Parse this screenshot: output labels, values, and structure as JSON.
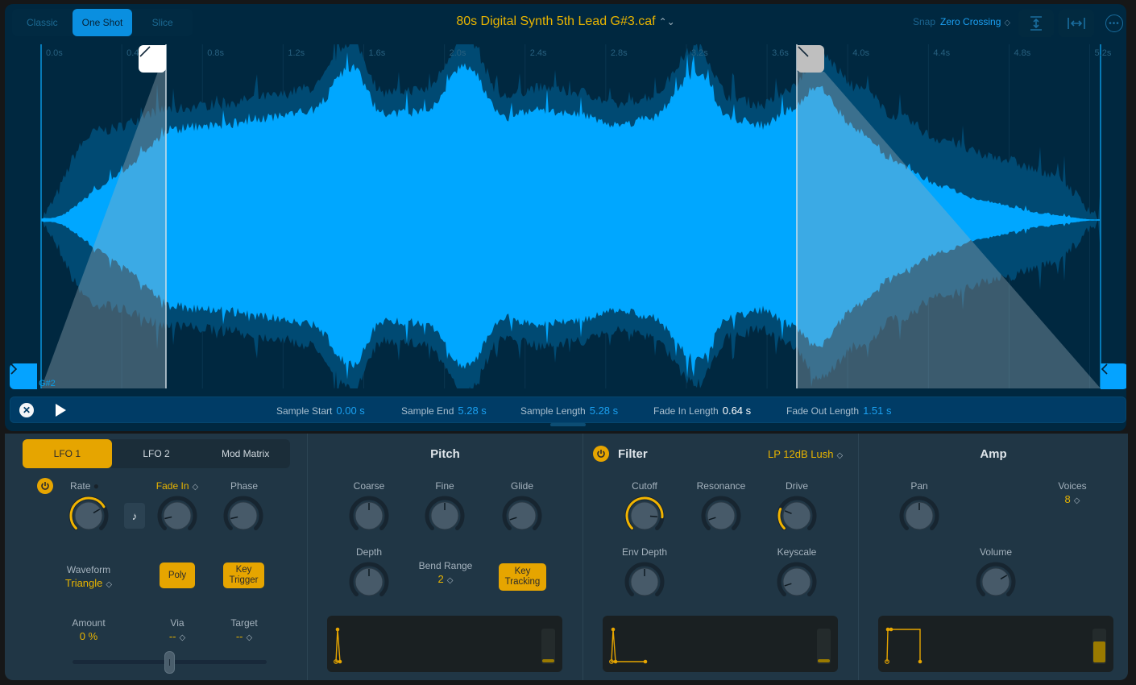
{
  "header": {
    "modes": [
      {
        "label": "Classic",
        "active": false
      },
      {
        "label": "One Shot",
        "active": true
      },
      {
        "label": "Slice",
        "active": false
      }
    ],
    "file_name": "80s Digital Synth 5th Lead G#3.caf",
    "snap_label": "Snap",
    "snap_value": "Zero Crossing",
    "tools": [
      "vertical-zoom-icon",
      "fit-horizontal-icon",
      "more-icon"
    ]
  },
  "waveform": {
    "ruler": [
      "0.0s",
      "0.4s",
      "0.8s",
      "1.2s",
      "1.6s",
      "2.0s",
      "2.4s",
      "2.8s",
      "3.2s",
      "3.6s",
      "4.0s",
      "4.4s",
      "4.8s",
      "5.2s"
    ],
    "root_note": "G#2",
    "colors": {
      "wave": "#00a7ff",
      "wave_dim": "#004a73",
      "background": "#002840",
      "fade": "#9bb0ba"
    }
  },
  "info_bar": {
    "items": [
      {
        "label": "Sample Start",
        "value": "0.00 s",
        "highlight": false
      },
      {
        "label": "Sample End",
        "value": "5.28 s",
        "highlight": false
      },
      {
        "label": "Sample Length",
        "value": "5.28 s",
        "highlight": false
      },
      {
        "label": "Fade In Length",
        "value": "0.64 s",
        "highlight": true
      },
      {
        "label": "Fade Out Length",
        "value": "1.51 s",
        "highlight": false
      }
    ]
  },
  "lfo": {
    "tabs": [
      {
        "label": "LFO 1",
        "active": true
      },
      {
        "label": "LFO 2",
        "active": false
      },
      {
        "label": "Mod Matrix",
        "active": false
      }
    ],
    "rate_label": "Rate",
    "fade_label": "Fade In",
    "phase_label": "Phase",
    "waveform_label": "Waveform",
    "waveform_value": "Triangle",
    "poly_label": "Poly",
    "key_trigger_label": "Key Trigger",
    "amount_label": "Amount",
    "amount_value": "0 %",
    "via_label": "Via",
    "via_value": "--",
    "target_label": "Target",
    "target_value": "--",
    "amount_slider": 0.5
  },
  "pitch": {
    "title": "Pitch",
    "coarse_label": "Coarse",
    "fine_label": "Fine",
    "glide_label": "Glide",
    "depth_label": "Depth",
    "bend_range_label": "Bend Range",
    "bend_range_value": "2",
    "key_tracking_label": "Key Tracking",
    "env_meter": 0.05
  },
  "filter": {
    "title": "Filter",
    "type": "LP 12dB Lush",
    "cutoff_label": "Cutoff",
    "resonance_label": "Resonance",
    "drive_label": "Drive",
    "env_depth_label": "Env Depth",
    "keyscale_label": "Keyscale",
    "env_meter": 0.05
  },
  "amp": {
    "title": "Amp",
    "pan_label": "Pan",
    "voices_label": "Voices",
    "voices_value": "8",
    "volume_label": "Volume",
    "env_meter": 0.65
  },
  "accent": "#e6a500"
}
